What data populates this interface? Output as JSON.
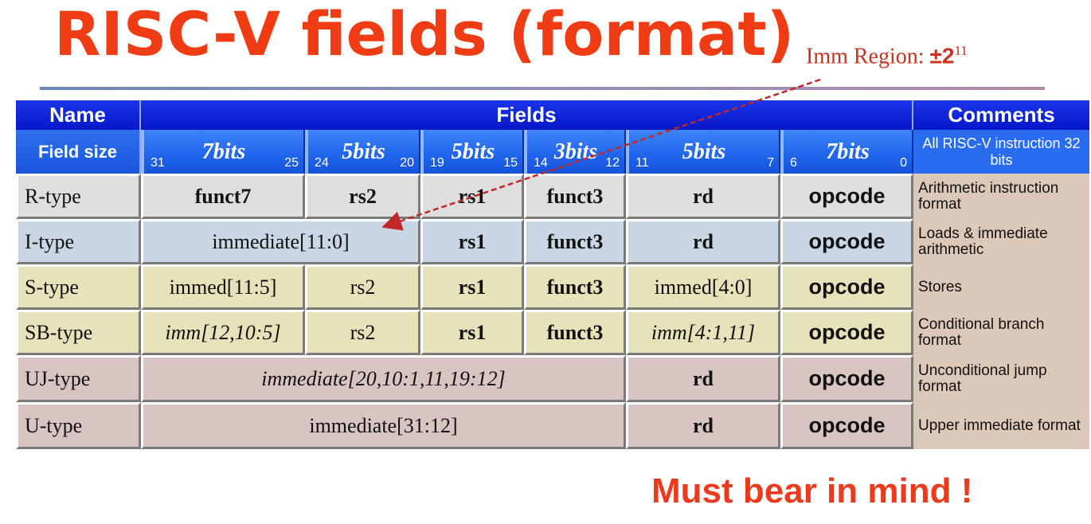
{
  "title": "RISC-V fields (format)",
  "imm_note": {
    "label": "Imm Region:",
    "pm": "±2",
    "exp": "11"
  },
  "footer": "Must bear in mind !",
  "header": {
    "name": "Name",
    "fields": "Fields",
    "comments": "Comments"
  },
  "field_size": {
    "label": "Field size",
    "cols": [
      {
        "hi": "31",
        "bits": "7bits",
        "lo": "25"
      },
      {
        "hi": "24",
        "bits": "5bits",
        "lo": "20"
      },
      {
        "hi": "19",
        "bits": "5bits",
        "lo": "15"
      },
      {
        "hi": "14",
        "bits": "3bits",
        "lo": "12"
      },
      {
        "hi": "11",
        "bits": "5bits",
        "lo": "7"
      },
      {
        "hi": "6",
        "bits": "7bits",
        "lo": "0"
      }
    ],
    "comment": "All RISC-V instruction 32 bits"
  },
  "rows": [
    {
      "name": "R-type",
      "f": [
        "funct7",
        "rs2",
        "rs1",
        "funct3",
        "rd",
        "opcode"
      ],
      "comment": "Arithmetic instruction format"
    },
    {
      "name": "I-type",
      "f": [
        "immediate[11:0]",
        "rs1",
        "funct3",
        "rd",
        "opcode"
      ],
      "comment": "Loads & immediate arithmetic"
    },
    {
      "name": "S-type",
      "f": [
        "immed[11:5]",
        "rs2",
        "rs1",
        "funct3",
        "immed[4:0]",
        "opcode"
      ],
      "comment": "Stores"
    },
    {
      "name": "SB-type",
      "f": [
        "imm[12,10:5]",
        "rs2",
        "rs1",
        "funct3",
        "imm[4:1,11]",
        "opcode"
      ],
      "comment": "Conditional branch format"
    },
    {
      "name": "UJ-type",
      "f": [
        "immediate[20,10:1,11,19:12]",
        "rd",
        "opcode"
      ],
      "comment": "Unconditional jump format"
    },
    {
      "name": "U-type",
      "f": [
        "immediate[31:12]",
        "rd",
        "opcode"
      ],
      "comment": "Upper immediate format"
    }
  ],
  "colors": {
    "title": "#f03c14",
    "header_blue": "#0b22d8",
    "size_blue": "#2a6cf0",
    "arrow": "#c0282a"
  }
}
